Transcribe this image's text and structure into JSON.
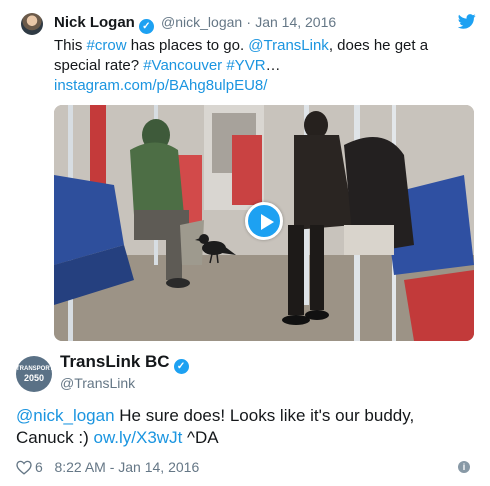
{
  "tweet": {
    "author_name": "Nick Logan",
    "author_handle": "@nick_logan",
    "separator": "·",
    "date": "Jan 14, 2016",
    "text_parts": {
      "p1": "This ",
      "crow_tag": "#crow",
      "p2": " has places to go. ",
      "translink_mention": "@TransLink",
      "p3": ", does he get a special rate? ",
      "vancouver_tag": "#Vancouver",
      "p4": " ",
      "yvr_tag": "#YVR",
      "p5": "…",
      "url": "instagram.com/p/BAhg8ulpEU8/"
    },
    "bird_icon": "twitter-bird-icon",
    "verified_icon": "verified-badge-icon",
    "media": {
      "description_icon": "video-thumbnail",
      "play_icon": "play-icon"
    }
  },
  "reply": {
    "author_name": "TransLink BC",
    "author_handle": "@TransLink",
    "avatar_text_top": "TRANSPORT",
    "avatar_text_big": "2050",
    "text_parts": {
      "mention": "@nick_logan",
      "p1": " He sure does! Looks like it's our buddy, Canuck :) ",
      "link": "ow.ly/X3wJt",
      "p2": " ^DA"
    },
    "likes": "6",
    "timestamp": "8:22 AM - Jan 14, 2016",
    "heart_icon": "heart-icon",
    "info_icon": "info-icon"
  },
  "colors": {
    "accent": "#1da1f2",
    "link": "#1b95e0",
    "muted": "#657786"
  }
}
